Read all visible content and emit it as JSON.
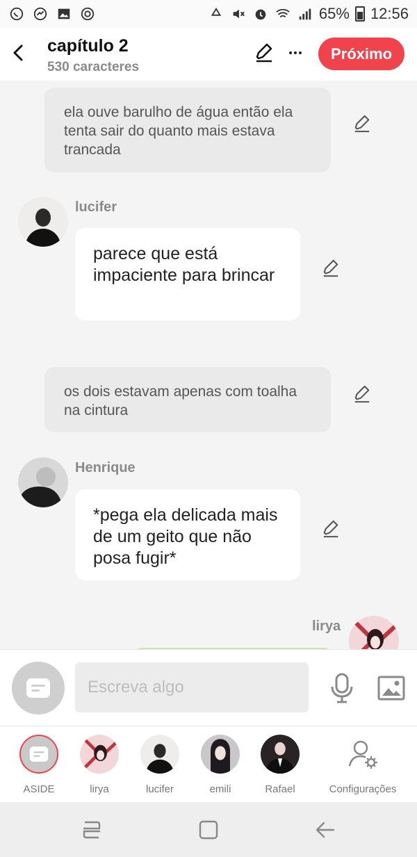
{
  "status_bar": {
    "battery": "65%",
    "time": "12:56",
    "left_icons": [
      "whatsapp-icon",
      "messenger-icon",
      "gallery-icon",
      "sync-icon"
    ],
    "right_icons": [
      "recycle-icon",
      "mute-icon",
      "alarm-icon",
      "wifi-icon",
      "signal-icon",
      "battery-icon"
    ]
  },
  "header": {
    "title": "capítulo 2",
    "subtitle": "530 caracteres",
    "next_label": "Próximo"
  },
  "messages": [
    {
      "type": "narration",
      "text": "ela ouve barulho de água  então ela tenta sair do quanto mais estava trancada"
    },
    {
      "type": "character",
      "name": "lucifer",
      "text": "parece que está impaciente para brincar"
    },
    {
      "type": "narration",
      "text": "os dois estavam apenas com toalha na cintura"
    },
    {
      "type": "character",
      "name": "Henrique",
      "text": "*pega ela delicada mais de um geito que não posa fugir*"
    },
    {
      "type": "self",
      "name": "lirya",
      "text": ""
    }
  ],
  "input": {
    "placeholder": "Escreva algo"
  },
  "characters": [
    {
      "label": "ASIDE"
    },
    {
      "label": "lirya"
    },
    {
      "label": "lucifer"
    },
    {
      "label": "emili"
    },
    {
      "label": "Rafael"
    },
    {
      "label": "Configurações"
    }
  ],
  "colors": {
    "accent": "#f0434b",
    "chat_background": "#f4f4f4",
    "narration_bubble": "#eaeaea",
    "character_bubble": "#ffffff",
    "self_bubble": "#eaf3dd"
  }
}
